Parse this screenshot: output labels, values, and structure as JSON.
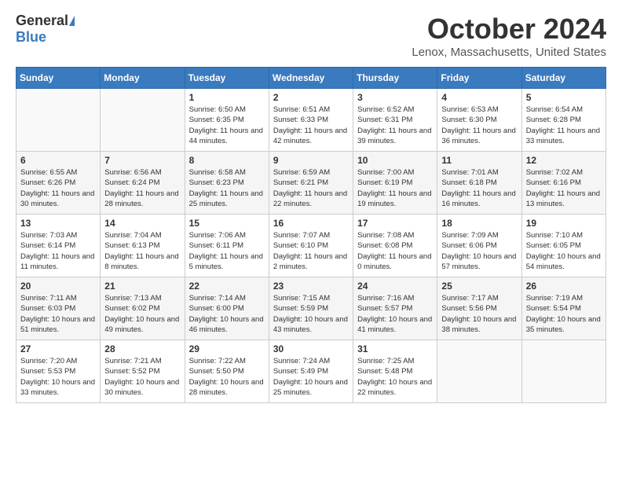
{
  "logo": {
    "general": "General",
    "blue": "Blue"
  },
  "title": "October 2024",
  "location": "Lenox, Massachusetts, United States",
  "days_header": [
    "Sunday",
    "Monday",
    "Tuesday",
    "Wednesday",
    "Thursday",
    "Friday",
    "Saturday"
  ],
  "weeks": [
    [
      {
        "day": "",
        "info": ""
      },
      {
        "day": "",
        "info": ""
      },
      {
        "day": "1",
        "info": "Sunrise: 6:50 AM\nSunset: 6:35 PM\nDaylight: 11 hours and 44 minutes."
      },
      {
        "day": "2",
        "info": "Sunrise: 6:51 AM\nSunset: 6:33 PM\nDaylight: 11 hours and 42 minutes."
      },
      {
        "day": "3",
        "info": "Sunrise: 6:52 AM\nSunset: 6:31 PM\nDaylight: 11 hours and 39 minutes."
      },
      {
        "day": "4",
        "info": "Sunrise: 6:53 AM\nSunset: 6:30 PM\nDaylight: 11 hours and 36 minutes."
      },
      {
        "day": "5",
        "info": "Sunrise: 6:54 AM\nSunset: 6:28 PM\nDaylight: 11 hours and 33 minutes."
      }
    ],
    [
      {
        "day": "6",
        "info": "Sunrise: 6:55 AM\nSunset: 6:26 PM\nDaylight: 11 hours and 30 minutes."
      },
      {
        "day": "7",
        "info": "Sunrise: 6:56 AM\nSunset: 6:24 PM\nDaylight: 11 hours and 28 minutes."
      },
      {
        "day": "8",
        "info": "Sunrise: 6:58 AM\nSunset: 6:23 PM\nDaylight: 11 hours and 25 minutes."
      },
      {
        "day": "9",
        "info": "Sunrise: 6:59 AM\nSunset: 6:21 PM\nDaylight: 11 hours and 22 minutes."
      },
      {
        "day": "10",
        "info": "Sunrise: 7:00 AM\nSunset: 6:19 PM\nDaylight: 11 hours and 19 minutes."
      },
      {
        "day": "11",
        "info": "Sunrise: 7:01 AM\nSunset: 6:18 PM\nDaylight: 11 hours and 16 minutes."
      },
      {
        "day": "12",
        "info": "Sunrise: 7:02 AM\nSunset: 6:16 PM\nDaylight: 11 hours and 13 minutes."
      }
    ],
    [
      {
        "day": "13",
        "info": "Sunrise: 7:03 AM\nSunset: 6:14 PM\nDaylight: 11 hours and 11 minutes."
      },
      {
        "day": "14",
        "info": "Sunrise: 7:04 AM\nSunset: 6:13 PM\nDaylight: 11 hours and 8 minutes."
      },
      {
        "day": "15",
        "info": "Sunrise: 7:06 AM\nSunset: 6:11 PM\nDaylight: 11 hours and 5 minutes."
      },
      {
        "day": "16",
        "info": "Sunrise: 7:07 AM\nSunset: 6:10 PM\nDaylight: 11 hours and 2 minutes."
      },
      {
        "day": "17",
        "info": "Sunrise: 7:08 AM\nSunset: 6:08 PM\nDaylight: 11 hours and 0 minutes."
      },
      {
        "day": "18",
        "info": "Sunrise: 7:09 AM\nSunset: 6:06 PM\nDaylight: 10 hours and 57 minutes."
      },
      {
        "day": "19",
        "info": "Sunrise: 7:10 AM\nSunset: 6:05 PM\nDaylight: 10 hours and 54 minutes."
      }
    ],
    [
      {
        "day": "20",
        "info": "Sunrise: 7:11 AM\nSunset: 6:03 PM\nDaylight: 10 hours and 51 minutes."
      },
      {
        "day": "21",
        "info": "Sunrise: 7:13 AM\nSunset: 6:02 PM\nDaylight: 10 hours and 49 minutes."
      },
      {
        "day": "22",
        "info": "Sunrise: 7:14 AM\nSunset: 6:00 PM\nDaylight: 10 hours and 46 minutes."
      },
      {
        "day": "23",
        "info": "Sunrise: 7:15 AM\nSunset: 5:59 PM\nDaylight: 10 hours and 43 minutes."
      },
      {
        "day": "24",
        "info": "Sunrise: 7:16 AM\nSunset: 5:57 PM\nDaylight: 10 hours and 41 minutes."
      },
      {
        "day": "25",
        "info": "Sunrise: 7:17 AM\nSunset: 5:56 PM\nDaylight: 10 hours and 38 minutes."
      },
      {
        "day": "26",
        "info": "Sunrise: 7:19 AM\nSunset: 5:54 PM\nDaylight: 10 hours and 35 minutes."
      }
    ],
    [
      {
        "day": "27",
        "info": "Sunrise: 7:20 AM\nSunset: 5:53 PM\nDaylight: 10 hours and 33 minutes."
      },
      {
        "day": "28",
        "info": "Sunrise: 7:21 AM\nSunset: 5:52 PM\nDaylight: 10 hours and 30 minutes."
      },
      {
        "day": "29",
        "info": "Sunrise: 7:22 AM\nSunset: 5:50 PM\nDaylight: 10 hours and 28 minutes."
      },
      {
        "day": "30",
        "info": "Sunrise: 7:24 AM\nSunset: 5:49 PM\nDaylight: 10 hours and 25 minutes."
      },
      {
        "day": "31",
        "info": "Sunrise: 7:25 AM\nSunset: 5:48 PM\nDaylight: 10 hours and 22 minutes."
      },
      {
        "day": "",
        "info": ""
      },
      {
        "day": "",
        "info": ""
      }
    ]
  ]
}
